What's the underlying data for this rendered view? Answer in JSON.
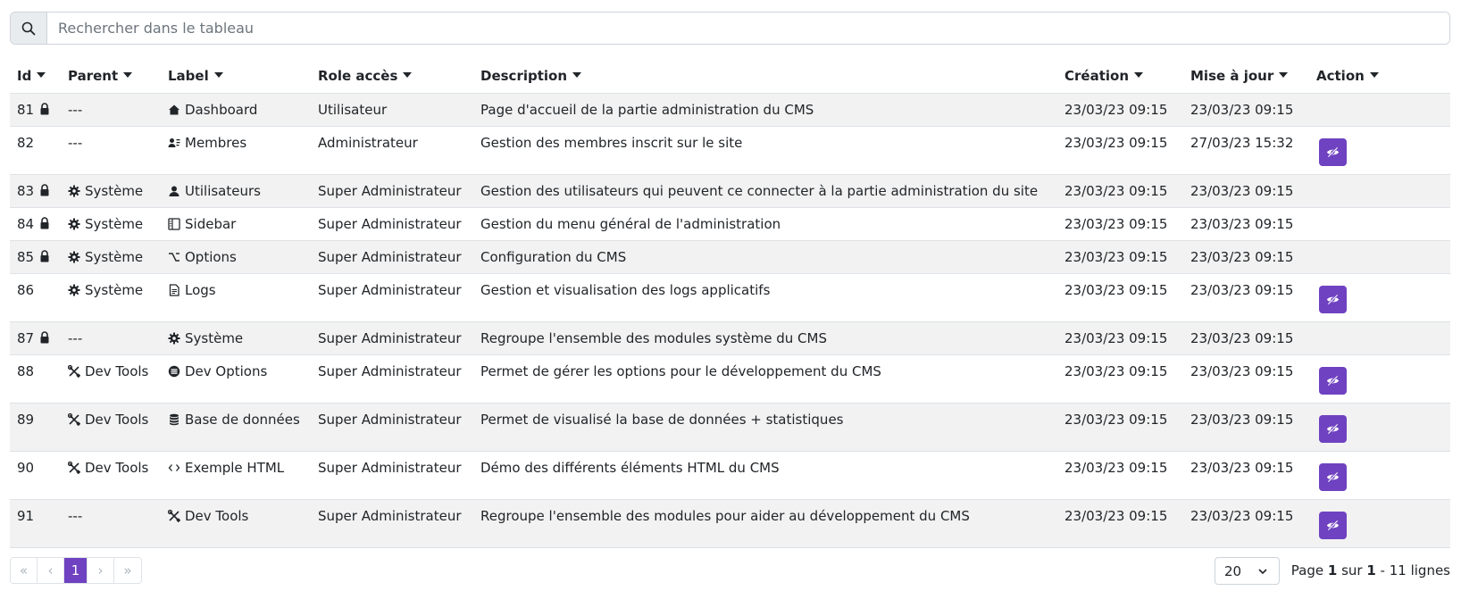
{
  "search": {
    "placeholder": "Rechercher dans le tableau",
    "value": ""
  },
  "table": {
    "columns": [
      "Id",
      "Parent",
      "Label",
      "Role accès",
      "Description",
      "Création",
      "Mise à jour",
      "Action"
    ],
    "rows": [
      {
        "id": "81",
        "locked": true,
        "parent": "---",
        "parent_icon": "",
        "label": "Dashboard",
        "label_icon": "home-icon",
        "role": "Utilisateur",
        "description": "Page d'accueil de la partie administration du CMS",
        "created": "23/03/23 09:15",
        "updated": "23/03/23 09:15",
        "has_action": false
      },
      {
        "id": "82",
        "locked": false,
        "parent": "---",
        "parent_icon": "",
        "label": "Membres",
        "label_icon": "members-icon",
        "role": "Administrateur",
        "description": "Gestion des membres inscrit sur le site",
        "created": "23/03/23 09:15",
        "updated": "27/03/23 15:32",
        "has_action": true
      },
      {
        "id": "83",
        "locked": true,
        "parent": "Système",
        "parent_icon": "gear-icon",
        "label": "Utilisateurs",
        "label_icon": "user-icon",
        "role": "Super Administrateur",
        "description": "Gestion des utilisateurs qui peuvent ce connecter à la partie administration du site",
        "created": "23/03/23 09:15",
        "updated": "23/03/23 09:15",
        "has_action": false
      },
      {
        "id": "84",
        "locked": true,
        "parent": "Système",
        "parent_icon": "gear-icon",
        "label": "Sidebar",
        "label_icon": "sidebar-icon",
        "role": "Super Administrateur",
        "description": "Gestion du menu général de l'administration",
        "created": "23/03/23 09:15",
        "updated": "23/03/23 09:15",
        "has_action": false
      },
      {
        "id": "85",
        "locked": true,
        "parent": "Système",
        "parent_icon": "gear-icon",
        "label": "Options",
        "label_icon": "option-icon",
        "role": "Super Administrateur",
        "description": "Configuration du CMS",
        "created": "23/03/23 09:15",
        "updated": "23/03/23 09:15",
        "has_action": false
      },
      {
        "id": "86",
        "locked": false,
        "parent": "Système",
        "parent_icon": "gear-icon",
        "label": "Logs",
        "label_icon": "file-icon",
        "role": "Super Administrateur",
        "description": "Gestion et visualisation des logs applicatifs",
        "created": "23/03/23 09:15",
        "updated": "23/03/23 09:15",
        "has_action": true
      },
      {
        "id": "87",
        "locked": true,
        "parent": "---",
        "parent_icon": "",
        "label": "Système",
        "label_icon": "gear-icon",
        "role": "Super Administrateur",
        "description": "Regroupe l'ensemble des modules système du CMS",
        "created": "23/03/23 09:15",
        "updated": "23/03/23 09:15",
        "has_action": false
      },
      {
        "id": "88",
        "locked": false,
        "parent": "Dev Tools",
        "parent_icon": "tools-icon",
        "label": "Dev Options",
        "label_icon": "circle-menu-icon",
        "role": "Super Administrateur",
        "description": "Permet de gérer les options pour le développement du CMS",
        "created": "23/03/23 09:15",
        "updated": "23/03/23 09:15",
        "has_action": true
      },
      {
        "id": "89",
        "locked": false,
        "parent": "Dev Tools",
        "parent_icon": "tools-icon",
        "label": "Base de données",
        "label_icon": "database-icon",
        "role": "Super Administrateur",
        "description": "Permet de visualisé la base de données + statistiques",
        "created": "23/03/23 09:15",
        "updated": "23/03/23 09:15",
        "has_action": true
      },
      {
        "id": "90",
        "locked": false,
        "parent": "Dev Tools",
        "parent_icon": "tools-icon",
        "label": "Exemple HTML",
        "label_icon": "code-icon",
        "role": "Super Administrateur",
        "description": "Démo des différents éléments HTML du CMS",
        "created": "23/03/23 09:15",
        "updated": "23/03/23 09:15",
        "has_action": true
      },
      {
        "id": "91",
        "locked": false,
        "parent": "---",
        "parent_icon": "",
        "label": "Dev Tools",
        "label_icon": "tools-icon",
        "role": "Super Administrateur",
        "description": "Regroupe l'ensemble des modules pour aider au développement du CMS",
        "created": "23/03/23 09:15",
        "updated": "23/03/23 09:15",
        "has_action": true
      }
    ]
  },
  "pagination": {
    "first": "«",
    "prev": "‹",
    "current": "1",
    "next": "›",
    "last": "»",
    "rows_per_page": "20",
    "info_prefix": "Page ",
    "info_page": "1",
    "info_sur": " sur ",
    "info_total_pages": "1",
    "info_suffix": " - 11 lignes"
  },
  "colors": {
    "accent": "#6f42c1",
    "stripe": "#f2f2f2",
    "border": "#dee2e6"
  }
}
